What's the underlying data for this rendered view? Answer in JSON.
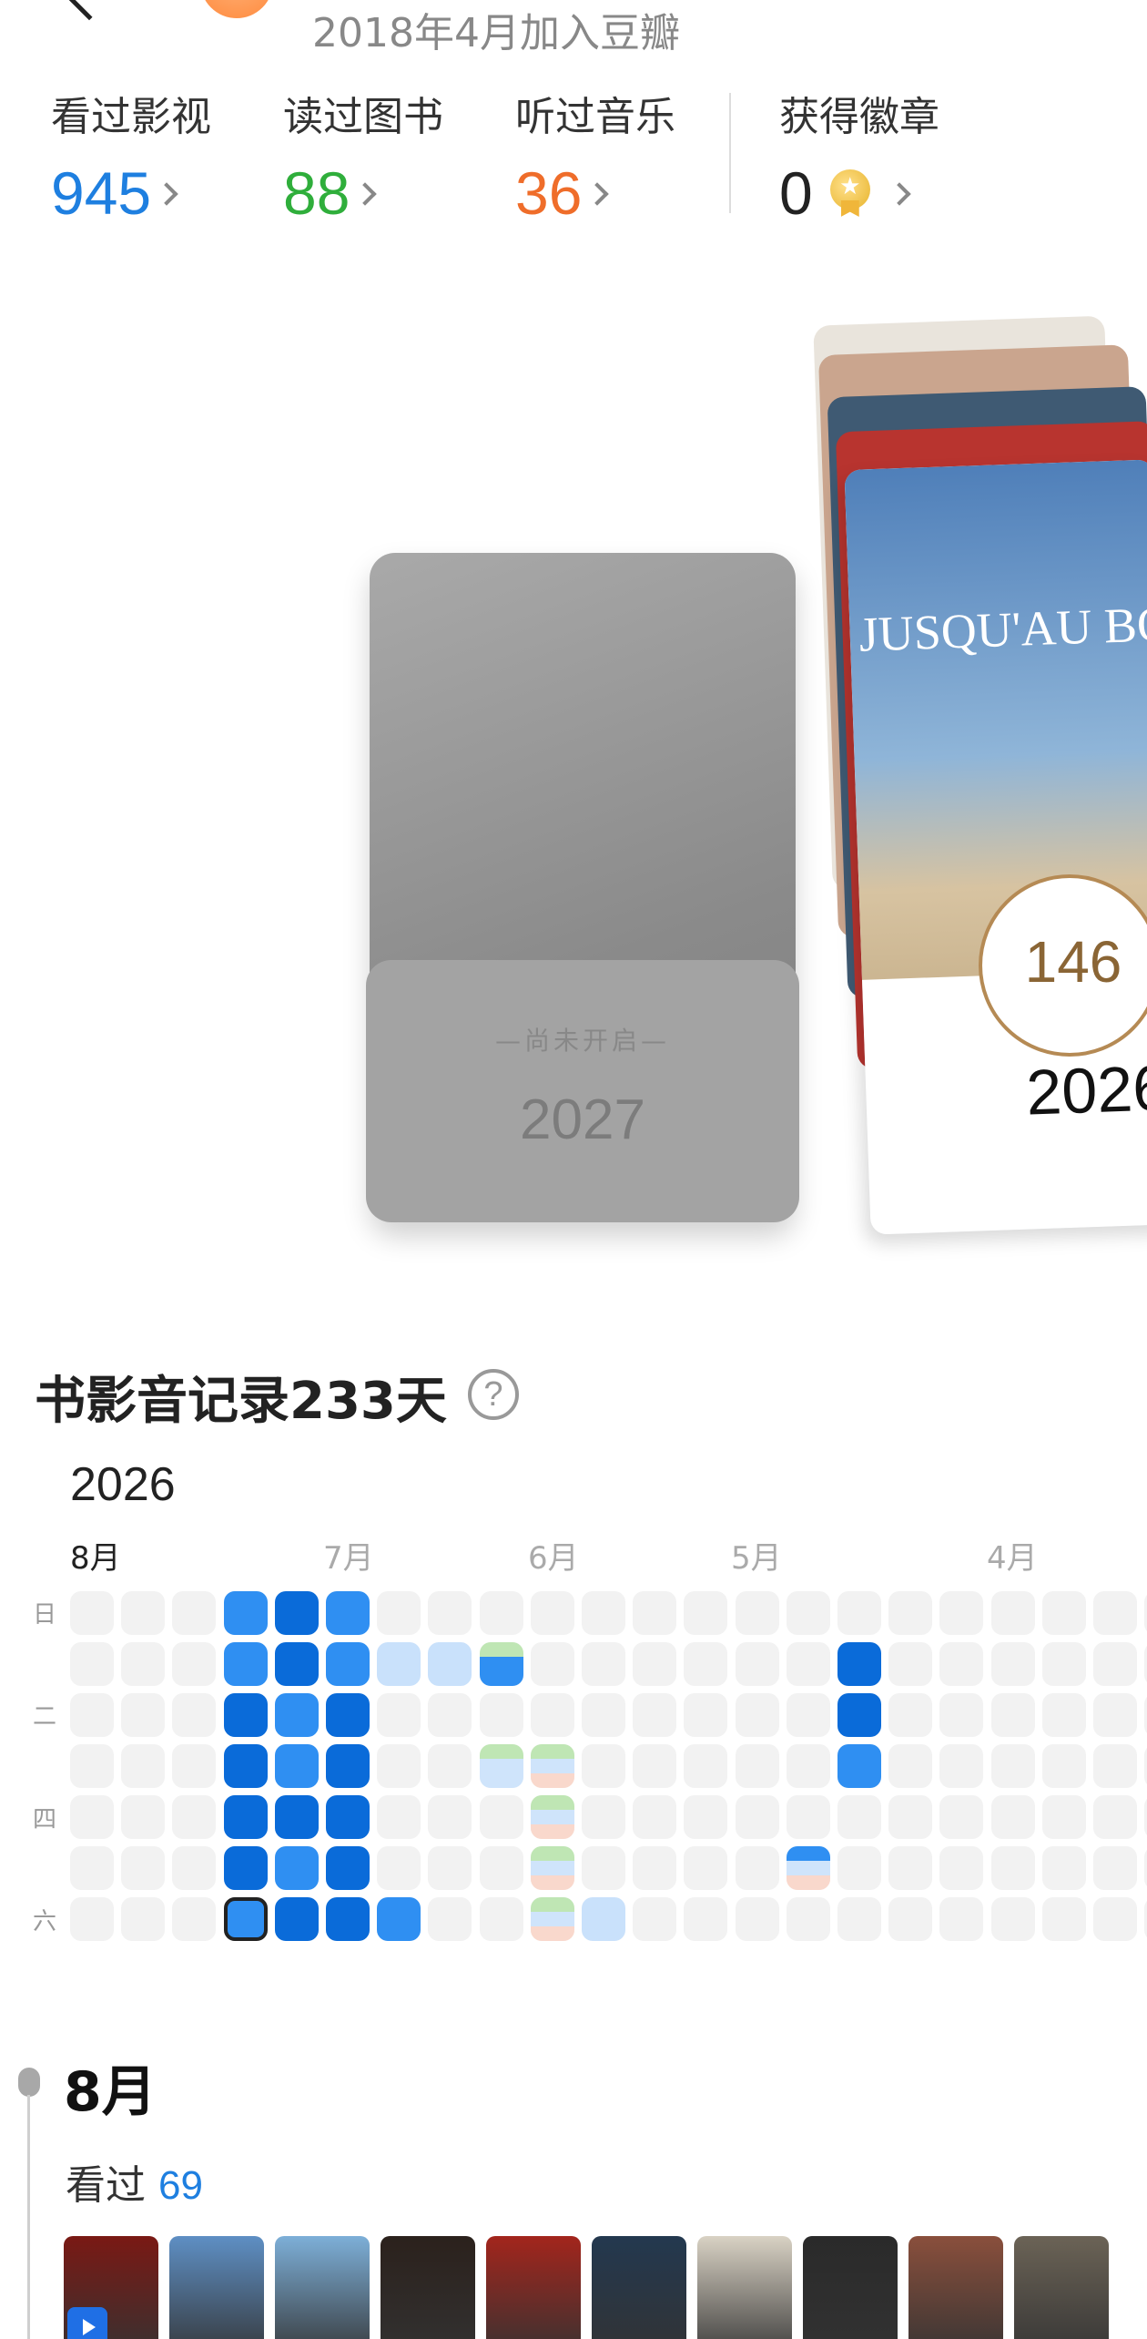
{
  "profile": {
    "joined": "2018年4月加入豆瓣"
  },
  "stats": [
    {
      "label": "看过影视",
      "value": "945",
      "color": "#1e7fe0"
    },
    {
      "label": "读过图书",
      "value": "88",
      "color": "#2fae3b"
    },
    {
      "label": "听过音乐",
      "value": "36",
      "color": "#ef6d2a"
    },
    {
      "label": "获得徽章",
      "value": "0",
      "color": "#222222"
    }
  ],
  "cards": {
    "locked": {
      "status": "—尚未开启—",
      "year": "2027"
    },
    "current": {
      "poster_title": "JUSQU'AU BOUT DU MONDE",
      "seal_number": "146",
      "year": "2026"
    }
  },
  "heatmap": {
    "title": "书影音记录233天",
    "year": "2026",
    "months": [
      "8月",
      "7月",
      "6月",
      "5月",
      "4月"
    ],
    "weekdays": [
      "日",
      "二",
      "四",
      "六"
    ],
    "colors": {
      "dark": "#0a6bd9",
      "mid": "#2f8ff2",
      "light": "#c9e1fb",
      "empty": "#f2f2f2",
      "green": "#bfe6b4",
      "blue": "#cfe4fb",
      "pink": "#f9d8cc"
    }
  },
  "month_section": {
    "title": "8月",
    "watched_label": "看过",
    "watched_count": "69",
    "posters": [
      "#7a1914",
      "#5e8fc4",
      "#7dafd8",
      "#2b211c",
      "#a3251c",
      "#23384f",
      "#d9d2c4",
      "#2a2a2a",
      "#8a4f3c",
      "#6b6356"
    ]
  }
}
